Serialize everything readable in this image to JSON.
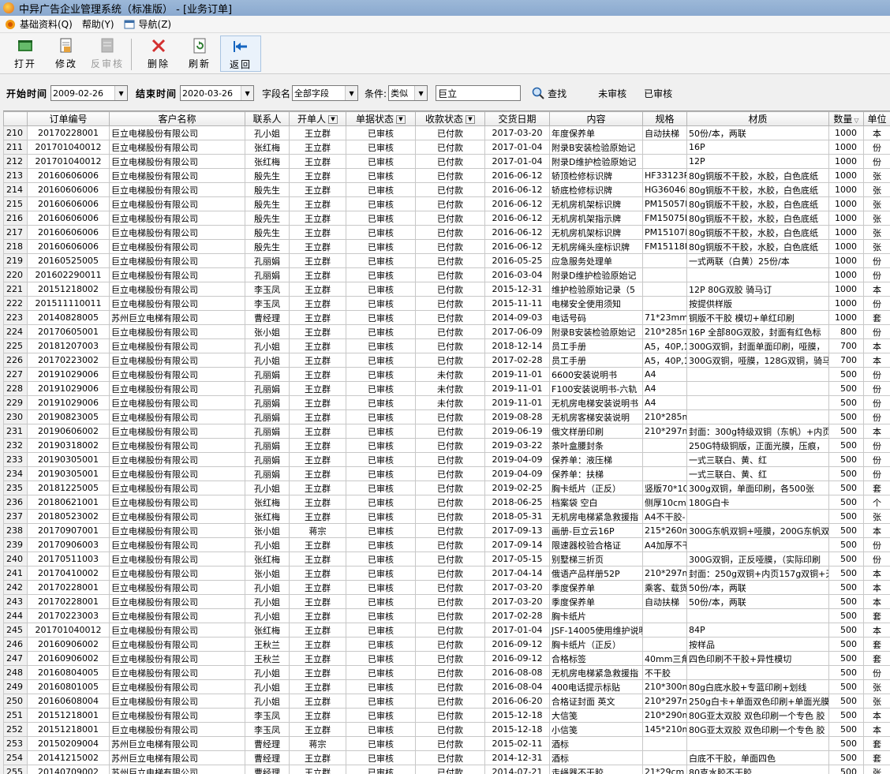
{
  "window": {
    "title": "中异广告企业管理系统（标准版） - [业务订单]"
  },
  "menubar": [
    {
      "label": "基础资料(Q)",
      "icon": "app-icon"
    },
    {
      "label": "帮助(Y)",
      "icon": ""
    },
    {
      "label": "导航(Z)",
      "icon": "window-icon"
    }
  ],
  "toolbar": {
    "open": "打开",
    "edit": "修改",
    "unreview": "反审核",
    "delete": "删除",
    "refresh": "刷新",
    "back": "返回"
  },
  "filter": {
    "start_label": "开始时间",
    "start_value": "2009-02-26",
    "end_label": "结束时间",
    "end_value": "2020-03-26",
    "field_label": "字段名",
    "field_value": "全部字段",
    "cond_label": "条件:",
    "cond_value": "类似",
    "keyword": "巨立",
    "search_label": "查找",
    "unreviewed_label": "未审核",
    "reviewed_label": "已审核"
  },
  "columns": [
    "",
    "订单编号",
    "客户名称",
    "联系人",
    "开单人",
    "单据状态",
    "收款状态",
    "交货日期",
    "内容",
    "规格",
    "材质",
    "数量",
    "单位"
  ],
  "rows": [
    [
      "210",
      "20170228001",
      "巨立电梯股份有限公司",
      "孔小姐",
      "王立群",
      "已审核",
      "已付款",
      "2017-03-20",
      "年度保养单",
      "自动扶梯",
      "50份/本，两联",
      "1000",
      "本"
    ],
    [
      "211",
      "201701040012",
      "巨立电梯股份有限公司",
      "张红梅",
      "王立群",
      "已审核",
      "已付款",
      "2017-01-04",
      "附录B安装检验原始记",
      "",
      "16P",
      "1000",
      "份"
    ],
    [
      "212",
      "201701040012",
      "巨立电梯股份有限公司",
      "张红梅",
      "王立群",
      "已审核",
      "已付款",
      "2017-01-04",
      "附录D维护检验原始记",
      "",
      "12P",
      "1000",
      "份"
    ],
    [
      "213",
      "20160606006",
      "巨立电梯股份有限公司",
      "殷先生",
      "王立群",
      "已审核",
      "已付款",
      "2016-06-12",
      "轿顶检修标识牌",
      "HF33123P",
      "80g铜版不干胶，水胶，白色底纸",
      "1000",
      "张"
    ],
    [
      "214",
      "20160606006",
      "巨立电梯股份有限公司",
      "殷先生",
      "王立群",
      "已审核",
      "已付款",
      "2016-06-12",
      "轿底检修标识牌",
      "HG36046F",
      "80g铜版不干胶，水胶，白色底纸",
      "1000",
      "张"
    ],
    [
      "215",
      "20160606006",
      "巨立电梯股份有限公司",
      "殷先生",
      "王立群",
      "已审核",
      "已付款",
      "2016-06-12",
      "无机房机架标识牌",
      "PM15057F",
      "80g铜版不干胶，水胶，白色底纸",
      "1000",
      "张"
    ],
    [
      "216",
      "20160606006",
      "巨立电梯股份有限公司",
      "殷先生",
      "王立群",
      "已审核",
      "已付款",
      "2016-06-12",
      "无机房机架指示牌",
      "FM15075F",
      "80g铜版不干胶，水胶，白色底纸",
      "1000",
      "张"
    ],
    [
      "217",
      "20160606006",
      "巨立电梯股份有限公司",
      "殷先生",
      "王立群",
      "已审核",
      "已付款",
      "2016-06-12",
      "无机房机架标识牌",
      "PM15107F",
      "80g铜版不干胶，水胶，白色底纸",
      "1000",
      "张"
    ],
    [
      "218",
      "20160606006",
      "巨立电梯股份有限公司",
      "殷先生",
      "王立群",
      "已审核",
      "已付款",
      "2016-06-12",
      "无机房绳头座标识牌",
      "FM15118F",
      "80g铜版不干胶，水胶，白色底纸",
      "1000",
      "张"
    ],
    [
      "219",
      "20160525005",
      "巨立电梯股份有限公司",
      "孔丽娟",
      "王立群",
      "已审核",
      "已付款",
      "2016-05-25",
      "应急服务处理单",
      "",
      "一式两联（白黄）25份/本",
      "1000",
      "份"
    ],
    [
      "220",
      "201602290011",
      "巨立电梯股份有限公司",
      "孔丽娟",
      "王立群",
      "已审核",
      "已付款",
      "2016-03-04",
      "附录D维护检验原始记",
      "",
      "",
      "1000",
      "份"
    ],
    [
      "221",
      "20151218002",
      "巨立电梯股份有限公司",
      "李玉凤",
      "王立群",
      "已审核",
      "已付款",
      "2015-12-31",
      "维护检验原始记录（5",
      "",
      "12P 80G双胶 骑马订",
      "1000",
      "本"
    ],
    [
      "222",
      "201511110011",
      "巨立电梯股份有限公司",
      "李玉凤",
      "王立群",
      "已审核",
      "已付款",
      "2015-11-11",
      "电梯安全使用须知",
      "",
      "按提供样版",
      "1000",
      "份"
    ],
    [
      "223",
      "20140828005",
      "苏州巨立电梯有限公司",
      "曹经理",
      "王立群",
      "已审核",
      "已付款",
      "2014-09-03",
      "电话号码",
      "71*23mm",
      "铜版不干胶 模切+单红印刷",
      "1000",
      "套"
    ],
    [
      "224",
      "20170605001",
      "巨立电梯股份有限公司",
      "张小姐",
      "王立群",
      "已审核",
      "已付款",
      "2017-06-09",
      "附录B安装检验原始记",
      "210*285mm",
      "16P 全部80G双胶，封面有红色标",
      "800",
      "份"
    ],
    [
      "225",
      "20181207003",
      "巨立电梯股份有限公司",
      "孔小姐",
      "王立群",
      "已审核",
      "已付款",
      "2018-12-14",
      "员工手册",
      "A5，40P,1",
      "300G双铜，封面单面印刷，哑膜，",
      "700",
      "本"
    ],
    [
      "226",
      "20170223002",
      "巨立电梯股份有限公司",
      "孔小姐",
      "王立群",
      "已审核",
      "已付款",
      "2017-02-28",
      "员工手册",
      "A5，40P,1",
      "300G双铜，哑膜，128G双铜，骑马",
      "700",
      "本"
    ],
    [
      "227",
      "20191029006",
      "巨立电梯股份有限公司",
      "孔丽娟",
      "王立群",
      "已审核",
      "未付款",
      "2019-11-01",
      "6600安装说明书",
      "A4",
      "",
      "500",
      "份"
    ],
    [
      "228",
      "20191029006",
      "巨立电梯股份有限公司",
      "孔丽娟",
      "王立群",
      "已审核",
      "未付款",
      "2019-11-01",
      "F100安装说明书-六轨",
      "A4",
      "",
      "500",
      "份"
    ],
    [
      "229",
      "20191029006",
      "巨立电梯股份有限公司",
      "孔丽娟",
      "王立群",
      "已审核",
      "未付款",
      "2019-11-01",
      "无机房电梯安装说明书",
      "A4",
      "",
      "500",
      "份"
    ],
    [
      "230",
      "20190823005",
      "巨立电梯股份有限公司",
      "孔丽娟",
      "王立群",
      "已审核",
      "已付款",
      "2019-08-28",
      "无机房客梯安装说明",
      "210*285mm",
      "",
      "500",
      "份"
    ],
    [
      "231",
      "20190606002",
      "巨立电梯股份有限公司",
      "孔丽娟",
      "王立群",
      "已审核",
      "已付款",
      "2019-06-19",
      "俄文样册印刷",
      "210*297mm",
      "封面：300g特级双铜（东帆）+内页",
      "500",
      "本"
    ],
    [
      "232",
      "20190318002",
      "巨立电梯股份有限公司",
      "孔丽娟",
      "王立群",
      "已审核",
      "已付款",
      "2019-03-22",
      "茶叶盒腰封条",
      "",
      "250G特级铜版，正面光膜，压痕，",
      "500",
      "份"
    ],
    [
      "233",
      "20190305001",
      "巨立电梯股份有限公司",
      "孔丽娟",
      "王立群",
      "已审核",
      "已付款",
      "2019-04-09",
      "保养单：液压梯",
      "",
      "一式三联白、黄、红",
      "500",
      "份"
    ],
    [
      "234",
      "20190305001",
      "巨立电梯股份有限公司",
      "孔丽娟",
      "王立群",
      "已审核",
      "已付款",
      "2019-04-09",
      "保养单：扶梯",
      "",
      "一式三联白、黄、红",
      "500",
      "份"
    ],
    [
      "235",
      "20181225005",
      "巨立电梯股份有限公司",
      "孔小姐",
      "王立群",
      "已审核",
      "已付款",
      "2019-02-25",
      "胸卡纸片（正反）",
      "竖版70*100",
      "300g双铜，单面印刷，各500张",
      "500",
      "套"
    ],
    [
      "236",
      "20180621001",
      "巨立电梯股份有限公司",
      "张红梅",
      "王立群",
      "已审核",
      "已付款",
      "2018-06-25",
      "档案袋 空白",
      "侧厚10cm",
      "180G白卡",
      "500",
      "个"
    ],
    [
      "237",
      "20180523002",
      "巨立电梯股份有限公司",
      "张红梅",
      "王立群",
      "已审核",
      "已付款",
      "2018-05-31",
      "无机房电梯紧急救援指",
      "A4不干胶-",
      "",
      "500",
      "张"
    ],
    [
      "238",
      "20170907001",
      "巨立电梯股份有限公司",
      "张小姐",
      "蒋宗",
      "已审核",
      "已付款",
      "2017-09-13",
      "画册-巨立云16P",
      "215*260mm",
      "300G东帆双铜+哑膜，200G东帆双",
      "500",
      "本"
    ],
    [
      "239",
      "20170906003",
      "巨立电梯股份有限公司",
      "孔小姐",
      "王立群",
      "已审核",
      "已付款",
      "2017-09-14",
      "限速器校验合格证",
      "A4加厚不干",
      "",
      "500",
      "份"
    ],
    [
      "240",
      "20170511003",
      "巨立电梯股份有限公司",
      "张红梅",
      "王立群",
      "已审核",
      "已付款",
      "2017-05-15",
      "别墅梯三折页",
      "",
      "300G双铜，正反哑膜，（实际印刷",
      "500",
      "份"
    ],
    [
      "241",
      "20170410002",
      "巨立电梯股份有限公司",
      "张小姐",
      "王立群",
      "已审核",
      "已付款",
      "2017-04-14",
      "俄语产品样册52P",
      "210*297mm",
      "封面：250g双铜+内页157g双铜+无",
      "500",
      "本"
    ],
    [
      "242",
      "20170228001",
      "巨立电梯股份有限公司",
      "孔小姐",
      "王立群",
      "已审核",
      "已付款",
      "2017-03-20",
      "季度保养单",
      "乘客、载货",
      "50份/本，两联",
      "500",
      "本"
    ],
    [
      "243",
      "20170228001",
      "巨立电梯股份有限公司",
      "孔小姐",
      "王立群",
      "已审核",
      "已付款",
      "2017-03-20",
      "季度保养单",
      "自动扶梯",
      "50份/本，两联",
      "500",
      "本"
    ],
    [
      "244",
      "20170223003",
      "巨立电梯股份有限公司",
      "孔小姐",
      "王立群",
      "已审核",
      "已付款",
      "2017-02-28",
      "胸卡纸片",
      "",
      "",
      "500",
      "套"
    ],
    [
      "245",
      "201701040012",
      "巨立电梯股份有限公司",
      "张红梅",
      "王立群",
      "已审核",
      "已付款",
      "2017-01-04",
      "JSF-14005使用维护说明",
      "",
      "84P",
      "500",
      "本"
    ],
    [
      "246",
      "20160906002",
      "巨立电梯股份有限公司",
      "王秋兰",
      "王立群",
      "已审核",
      "已付款",
      "2016-09-12",
      "胸卡纸片（正反）",
      "",
      "按样品",
      "500",
      "套"
    ],
    [
      "247",
      "20160906002",
      "巨立电梯股份有限公司",
      "王秋兰",
      "王立群",
      "已审核",
      "已付款",
      "2016-09-12",
      "合格标签",
      "40mm三角",
      "四色印刷不干胶+异性模切",
      "500",
      "套"
    ],
    [
      "248",
      "20160804005",
      "巨立电梯股份有限公司",
      "孔小姐",
      "王立群",
      "已审核",
      "已付款",
      "2016-08-08",
      "无机房电梯紧急救援指",
      "不干胶",
      "",
      "500",
      "份"
    ],
    [
      "249",
      "20160801005",
      "巨立电梯股份有限公司",
      "孔小姐",
      "王立群",
      "已审核",
      "已付款",
      "2016-08-04",
      "400电话提示标贴",
      "210*300mm",
      "80g白底水胶+专蓝印刷+划线",
      "500",
      "张"
    ],
    [
      "250",
      "20160608004",
      "巨立电梯股份有限公司",
      "孔小姐",
      "王立群",
      "已审核",
      "已付款",
      "2016-06-20",
      "合格证封面 英文",
      "210*297mm",
      "250g白卡+单面双色印刷+单面光膜",
      "500",
      "张"
    ],
    [
      "251",
      "20151218001",
      "巨立电梯股份有限公司",
      "李玉凤",
      "王立群",
      "已审核",
      "已付款",
      "2015-12-18",
      "大信笺",
      "210*290mm",
      "80G亚太双胶 双色印刷一个专色 胶",
      "500",
      "本"
    ],
    [
      "252",
      "20151218001",
      "巨立电梯股份有限公司",
      "李玉凤",
      "王立群",
      "已审核",
      "已付款",
      "2015-12-18",
      "小信笺",
      "145*210mm",
      "80G亚太双胶 双色印刷一个专色 胶",
      "500",
      "本"
    ],
    [
      "253",
      "20150209004",
      "苏州巨立电梯有限公司",
      "曹经理",
      "蒋宗",
      "已审核",
      "已付款",
      "2015-02-11",
      "酒标",
      "",
      "",
      "500",
      "套"
    ],
    [
      "254",
      "20141215002",
      "苏州巨立电梯有限公司",
      "曹经理",
      "王立群",
      "已审核",
      "已付款",
      "2014-12-31",
      "酒标",
      "",
      "白底不干胶，单面四色",
      "500",
      "套"
    ],
    [
      "255",
      "20140709002",
      "苏州巨立电梯有限公司",
      "曹经理",
      "王立群",
      "已审核",
      "已付款",
      "2014-07-21",
      "走绳器不干胶",
      "21*29cm",
      "80克水胶不干胶",
      "500",
      "张"
    ]
  ],
  "colors": {
    "titlebar": "#9cb8d8",
    "grid_border": "#c8c8c8",
    "header_bg": "#ebebeb"
  }
}
